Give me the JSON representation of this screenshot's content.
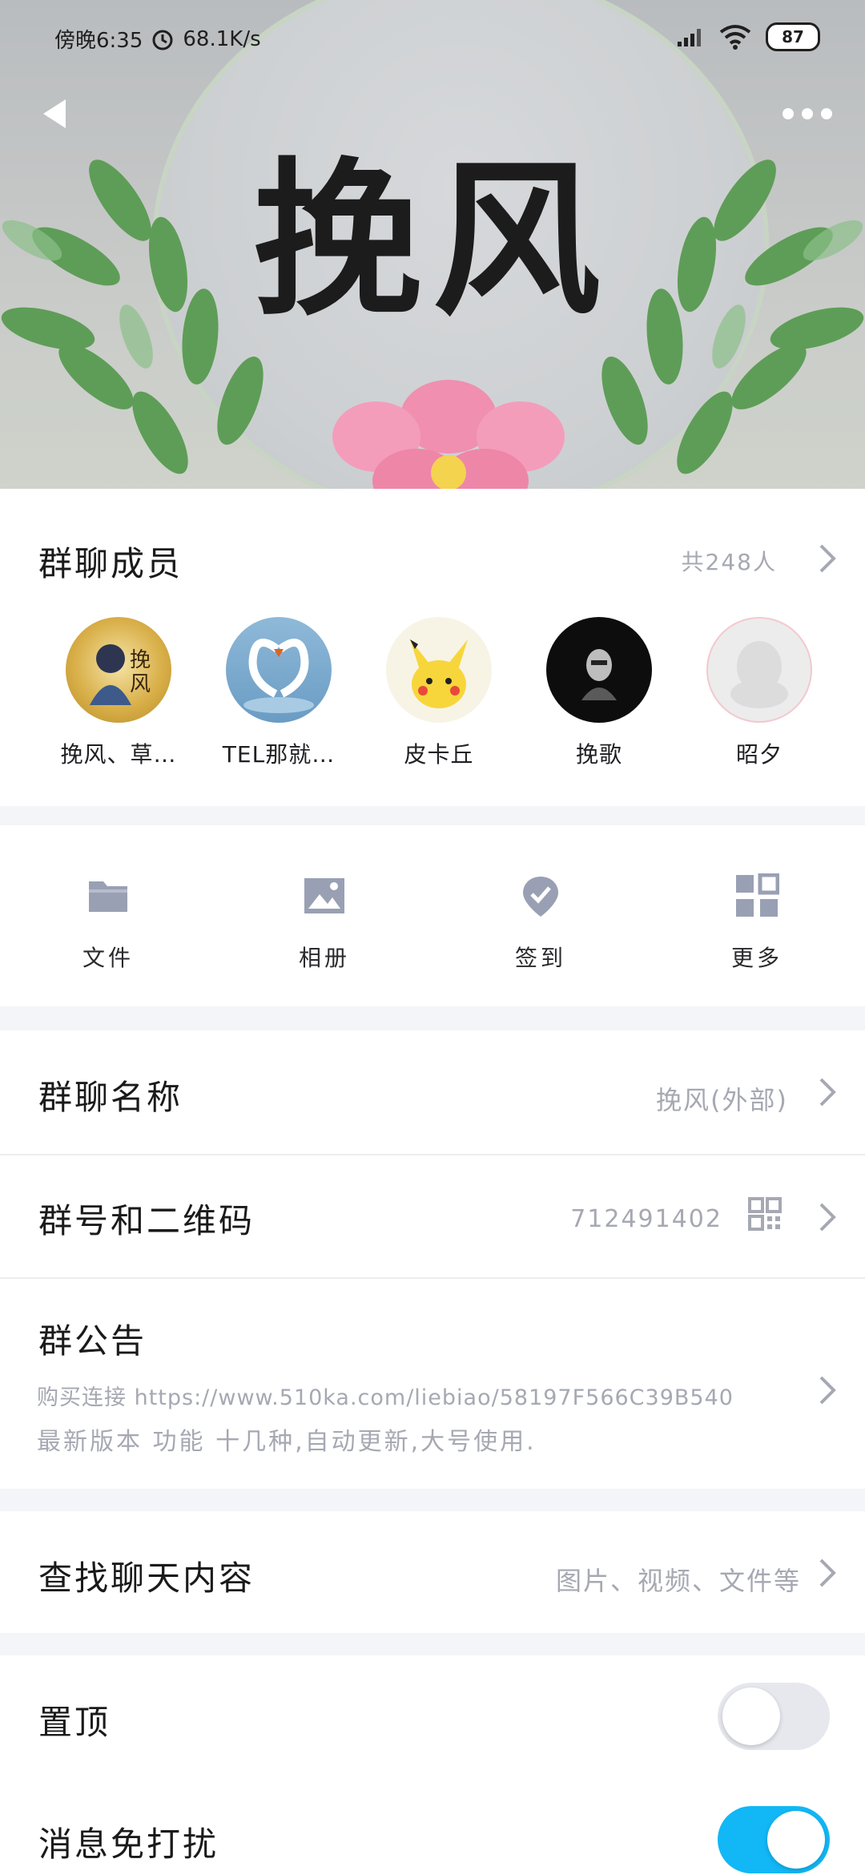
{
  "status_bar": {
    "time": "傍晚6:35",
    "net_speed": "68.1K/s",
    "battery": "87"
  },
  "header": {
    "banner_text": "挽风"
  },
  "members": {
    "title": "群聊成员",
    "count": "共248人",
    "list": [
      {
        "name": "挽风、草…"
      },
      {
        "name": "TEL那就…"
      },
      {
        "name": "皮卡丘"
      },
      {
        "name": "挽歌"
      },
      {
        "name": "昭夕"
      }
    ]
  },
  "tools": [
    {
      "label": "文件",
      "icon": "folder-icon"
    },
    {
      "label": "相册",
      "icon": "image-icon"
    },
    {
      "label": "签到",
      "icon": "checkin-icon"
    },
    {
      "label": "更多",
      "icon": "grid-icon"
    }
  ],
  "group_name": {
    "label": "群聊名称",
    "value": "挽风(外部)"
  },
  "group_id": {
    "label": "群号和二维码",
    "value": "712491402"
  },
  "notice": {
    "label": "群公告",
    "line1": "购买连接 https://www.510ka.com/liebiao/58197F566C39B540",
    "line2": "最新版本 功能 十几种,自动更新,大号使用."
  },
  "search": {
    "label": "查找聊天内容",
    "value": "图片、视频、文件等"
  },
  "pin": {
    "label": "置顶",
    "on": false
  },
  "mute": {
    "label": "消息免打扰",
    "on": true
  },
  "colors": {
    "accent": "#12b7f5",
    "toggle_off": "#e6e8ee",
    "hint": "#a6a8b2"
  }
}
